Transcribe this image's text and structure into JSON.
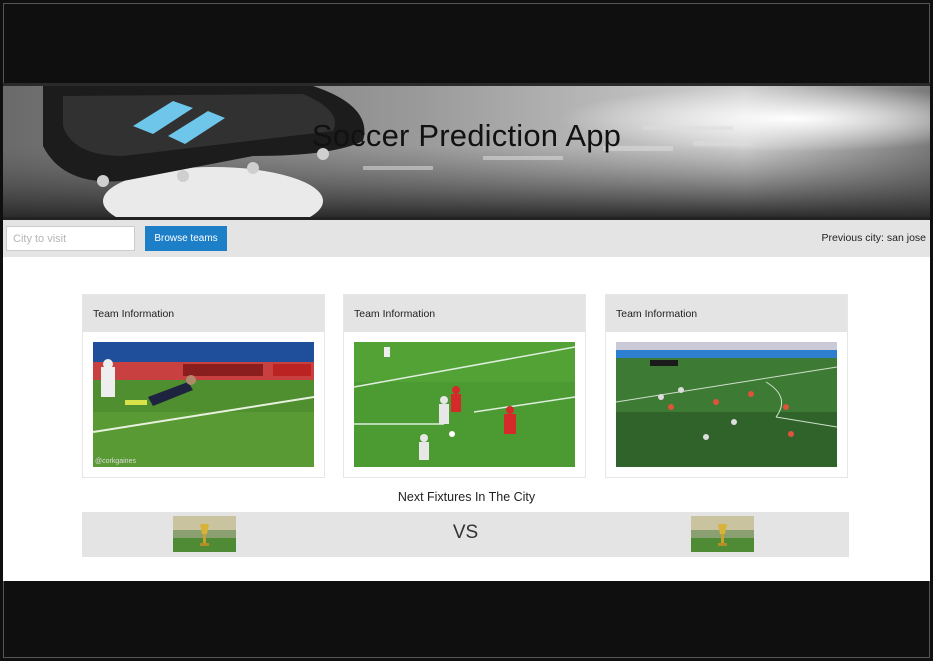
{
  "header": {
    "title": "Soccer Prediction App"
  },
  "search": {
    "placeholder": "City to visit",
    "button_label": "Browse teams"
  },
  "previous_city": {
    "text": "Previous city: san jose"
  },
  "cards": [
    {
      "header": "Team Information",
      "image": "soccer-match-photo-diving-header"
    },
    {
      "header": "Team Information",
      "image": "soccer-match-photo-players-running"
    },
    {
      "header": "Team Information",
      "image": "soccer-match-photo-aerial-pitch"
    }
  ],
  "card_watermark": "@corkgaines",
  "fixtures": {
    "title": "Next Fixtures In The City",
    "vs_label": "VS",
    "team_image": "trophy-stadium-thumbnail"
  },
  "colors": {
    "accent": "#1c7fc7",
    "panel": "#e4e4e4",
    "backdrop": "#0f0f0f"
  }
}
